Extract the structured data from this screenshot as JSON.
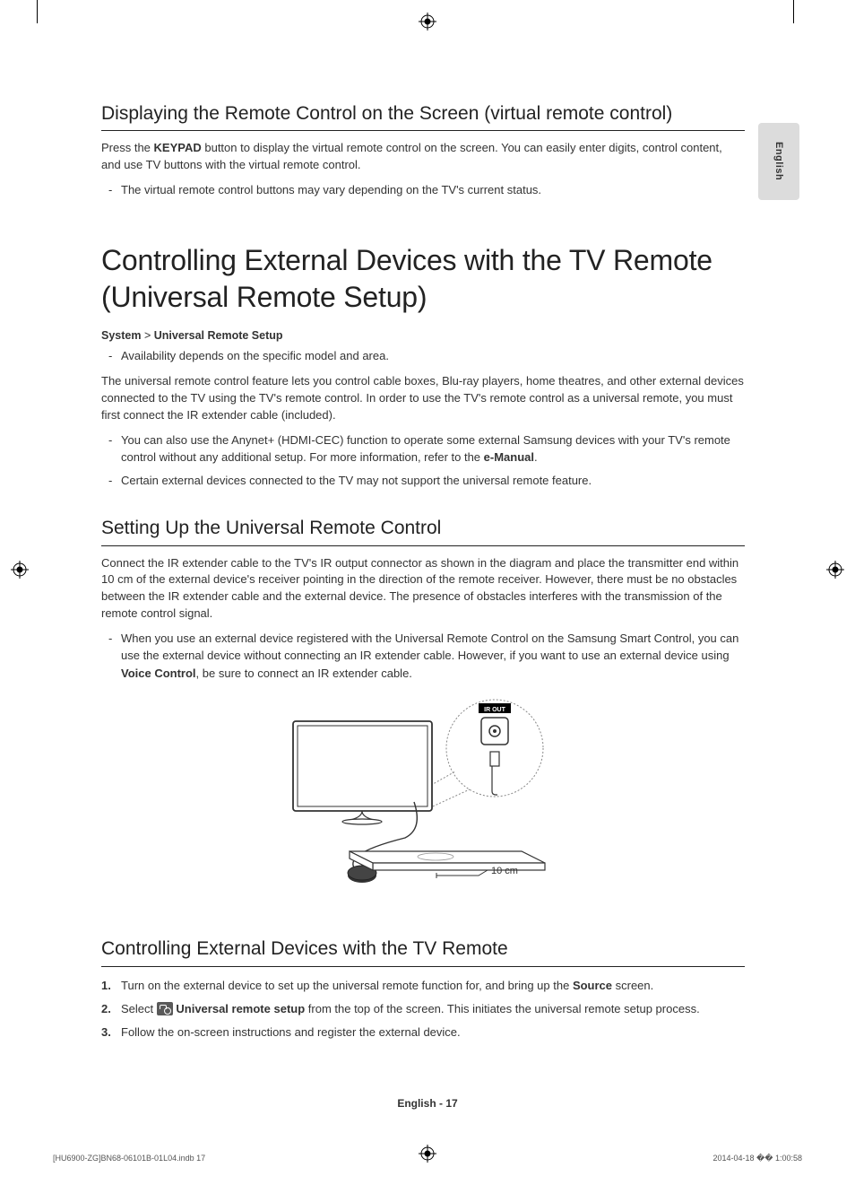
{
  "lang_tab": "English",
  "sec1": {
    "title": "Displaying the Remote Control on the Screen (virtual remote control)",
    "p1_a": "Press the ",
    "p1_bold": "KEYPAD",
    "p1_b": " button to display the virtual remote control on the screen. You can easily enter digits, control content, and use TV buttons with the virtual remote control.",
    "bullet1": "The virtual remote control buttons may vary depending on the TV's current status."
  },
  "main": {
    "title": "Controlling External Devices with the TV Remote (Universal Remote Setup)",
    "crumb_a": "System",
    "crumb_sep": " > ",
    "crumb_b": "Universal Remote Setup",
    "bullet1": "Availability depends on the specific model and area.",
    "p1": "The universal remote control feature lets you control cable boxes, Blu-ray players, home theatres, and other external devices connected to the TV using the TV's remote control. In order to use the TV's remote control as a universal remote, you must first connect the IR extender cable (included).",
    "bullet2_a": "You can also use the Anynet+ (HDMI-CEC) function to operate some external Samsung devices with your TV's remote control without any additional setup. For more information, refer to the ",
    "bullet2_bold": "e-Manual",
    "bullet2_b": ".",
    "bullet3": "Certain external devices connected to the TV may not support the universal remote feature."
  },
  "sec2": {
    "title": "Setting Up the Universal Remote Control",
    "p1": "Connect the IR extender cable to the TV's IR output connector as shown in the diagram and place the transmitter end within 10 cm of the external device's receiver pointing in the direction of the remote receiver. However, there must be no obstacles between the IR extender cable and the external device. The presence of obstacles interferes with the transmission of the remote control signal.",
    "bullet1_a": "When you use an external device registered with the Universal Remote Control on the Samsung Smart Control, you can use the external device without connecting an IR extender cable. However, if you want to use an external device using ",
    "bullet1_bold": "Voice Control",
    "bullet1_b": ", be sure to connect an IR extender cable.",
    "diagram": {
      "ir_out": "IR OUT",
      "dist": "10 cm"
    }
  },
  "sec3": {
    "title": "Controlling External Devices with the TV Remote",
    "step1_a": "Turn on the external device to set up the universal remote function for, and bring up the ",
    "step1_bold": "Source",
    "step1_b": " screen.",
    "step2_a": "Select ",
    "step2_bold": "Universal remote setup",
    "step2_b": " from the top of the screen. This initiates the universal remote setup process.",
    "step3": "Follow the on-screen instructions and register the external device."
  },
  "footer": "English - 17",
  "slug": {
    "left": "[HU6900-ZG]BN68-06101B-01L04.indb   17",
    "right": "2014-04-18   �� 1:00:58"
  }
}
